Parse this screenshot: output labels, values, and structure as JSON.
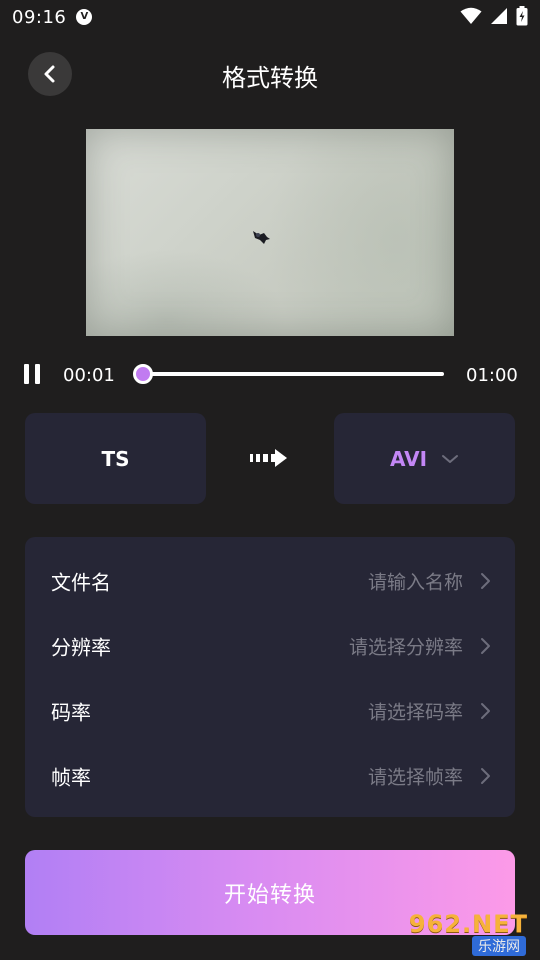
{
  "status_bar": {
    "time": "09:16",
    "shield_glyph": "V",
    "icons": [
      "shield-icon",
      "wifi-icon",
      "cell-signal-icon",
      "battery-icon"
    ]
  },
  "header": {
    "title": "格式转换",
    "back_icon": "chevron-left-icon"
  },
  "player": {
    "current_time": "00:01",
    "total_time": "01:00",
    "progress": 0.017,
    "pause_icon": "pause-icon",
    "accent_color": "#c17cf1"
  },
  "conversion": {
    "source_format": "TS",
    "target_format": "AVI",
    "arrow_icon": "arrow-right-icon",
    "dropdown_icon": "chevron-down-icon",
    "target_color": "#c387f6"
  },
  "settings": {
    "rows": [
      {
        "label": "文件名",
        "placeholder": "请输入名称"
      },
      {
        "label": "分辨率",
        "placeholder": "请选择分辨率"
      },
      {
        "label": "码率",
        "placeholder": "请选择码率"
      },
      {
        "label": "帧率",
        "placeholder": "请选择帧率"
      }
    ]
  },
  "actions": {
    "start_label": "开始转换",
    "gradient_start": "#b17ff4",
    "gradient_end": "#fc9ae8"
  },
  "watermark": {
    "main": "962.NET",
    "sub": "乐游网"
  }
}
